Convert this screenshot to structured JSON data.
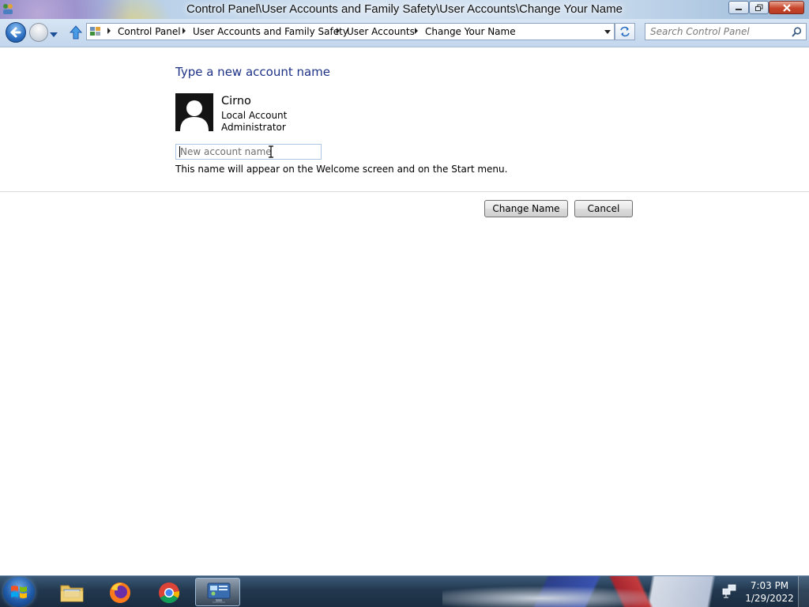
{
  "window": {
    "title": "Control Panel\\User Accounts and Family Safety\\User Accounts\\Change Your Name"
  },
  "addressbar": {
    "breadcrumbs": [
      "Control Panel",
      "User Accounts and Family Safety",
      "User Accounts",
      "Change Your Name"
    ],
    "search_placeholder": "Search Control Panel"
  },
  "content": {
    "heading": "Type a new account name",
    "user": {
      "name": "Cirno",
      "account_type": "Local Account",
      "role": "Administrator"
    },
    "input": {
      "placeholder": "New account name",
      "value": ""
    },
    "hint": "This name will appear on the Welcome screen and on the Start menu."
  },
  "buttons": {
    "change_name": "Change Name",
    "cancel": "Cancel"
  },
  "taskbar": {
    "items": [
      {
        "name": "windows-explorer",
        "icon": "folder-icon",
        "active": false
      },
      {
        "name": "firefox",
        "icon": "firefox-icon",
        "active": false
      },
      {
        "name": "chrome",
        "icon": "chrome-icon",
        "active": false
      },
      {
        "name": "control-panel",
        "icon": "control-panel-icon",
        "active": true
      }
    ],
    "clock": {
      "time": "7:03 PM",
      "date": "1/29/2022"
    }
  },
  "colors": {
    "heading": "#1e3287",
    "taskbar": "#22384f",
    "close_button": "#c8452b"
  }
}
